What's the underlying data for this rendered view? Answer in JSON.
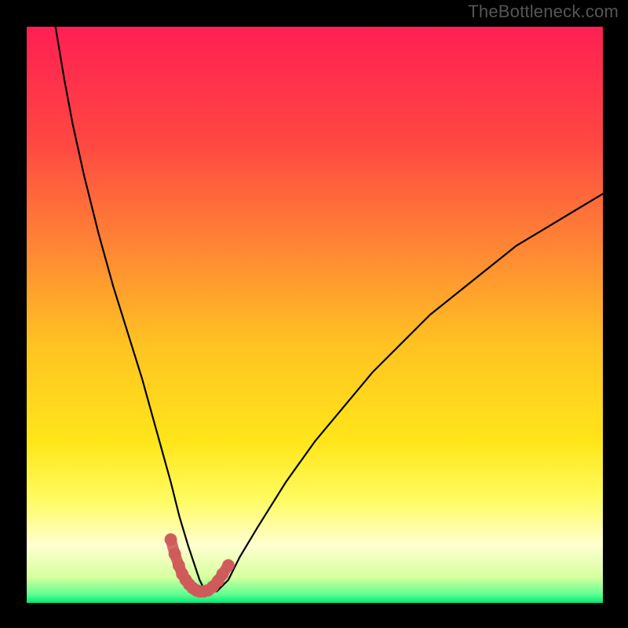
{
  "watermark": "TheBottleneck.com",
  "chart_data": {
    "type": "line",
    "title": "",
    "xlabel": "",
    "ylabel": "",
    "xlim": [
      0,
      100
    ],
    "ylim": [
      0,
      100
    ],
    "grid": false,
    "legend": false,
    "background_gradient": {
      "stops": [
        {
          "pos": 0.0,
          "color": "#ff1f53"
        },
        {
          "pos": 0.2,
          "color": "#ff4742"
        },
        {
          "pos": 0.4,
          "color": "#ff8c33"
        },
        {
          "pos": 0.55,
          "color": "#ffc222"
        },
        {
          "pos": 0.72,
          "color": "#ffe61a"
        },
        {
          "pos": 0.82,
          "color": "#fffb60"
        },
        {
          "pos": 0.9,
          "color": "#ffffd0"
        },
        {
          "pos": 0.955,
          "color": "#d8ffa0"
        },
        {
          "pos": 0.985,
          "color": "#60ff90"
        },
        {
          "pos": 1.0,
          "color": "#00e878"
        }
      ]
    },
    "series": [
      {
        "name": "curve",
        "stroke": "#000000",
        "x": [
          5,
          6.5,
          8,
          10,
          12.5,
          15,
          17.5,
          20,
          22.5,
          25,
          26.5,
          28,
          29,
          30,
          31,
          33,
          35,
          37,
          40,
          45,
          50,
          55,
          60,
          65,
          70,
          75,
          80,
          85,
          90,
          95,
          100
        ],
        "values": [
          100,
          91,
          83,
          74,
          64,
          55,
          47,
          39,
          30,
          21,
          15,
          10,
          7,
          4,
          2,
          2,
          4,
          8,
          13,
          21,
          28,
          34,
          40,
          45,
          50,
          54,
          58,
          62,
          65,
          68,
          71
        ]
      },
      {
        "name": "lower-marker",
        "type": "marker-strip",
        "stroke": "#cf5a5a",
        "x": [
          25,
          25.7,
          26.4,
          27,
          27.6,
          28.2,
          28.8,
          29.4,
          30,
          30.7,
          31.5,
          32.3,
          33.2,
          34,
          35
        ],
        "values": [
          11,
          8.5,
          6.5,
          5,
          4,
          3.2,
          2.6,
          2.2,
          2,
          2,
          2.2,
          2.8,
          3.8,
          5,
          6.5
        ]
      }
    ]
  }
}
